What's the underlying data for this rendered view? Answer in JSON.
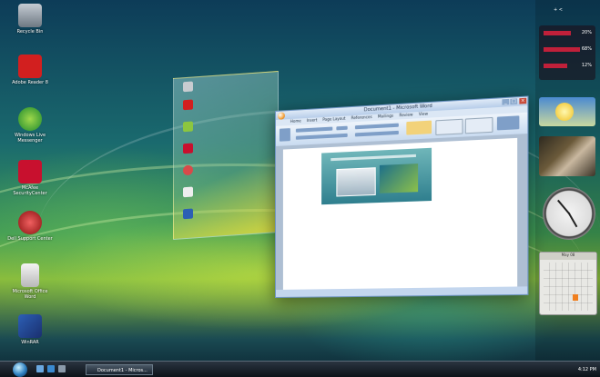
{
  "desktop": {
    "icons": [
      {
        "label": "Recycle Bin",
        "color": "#8f9aa5"
      },
      {
        "label": "Adobe Reader 8",
        "color": "#d21f1f"
      },
      {
        "label": "Windows Live Messenger",
        "color": "#e8b81c"
      },
      {
        "label": "McAfee SecurityCenter",
        "color": "#c8102e"
      },
      {
        "label": "Dell Support Center",
        "color": "#b22222"
      },
      {
        "label": "Microsoft Office Word",
        "color": "#d8d8d8"
      },
      {
        "label": "WinRAR",
        "color": "#2c5fb5"
      }
    ]
  },
  "word_window": {
    "title": "Document1 - Microsoft Word",
    "tabs": [
      "Home",
      "Insert",
      "Page Layout",
      "References",
      "Mailings",
      "Review",
      "View"
    ]
  },
  "taskbar": {
    "task_button": "Document1 - Micros...",
    "tray_time": "4:12 PM"
  },
  "sidebar": {
    "cpu_values": [
      "20%",
      "68%",
      "12%"
    ],
    "calendar_month": "May 08",
    "top_label": "+ <"
  }
}
